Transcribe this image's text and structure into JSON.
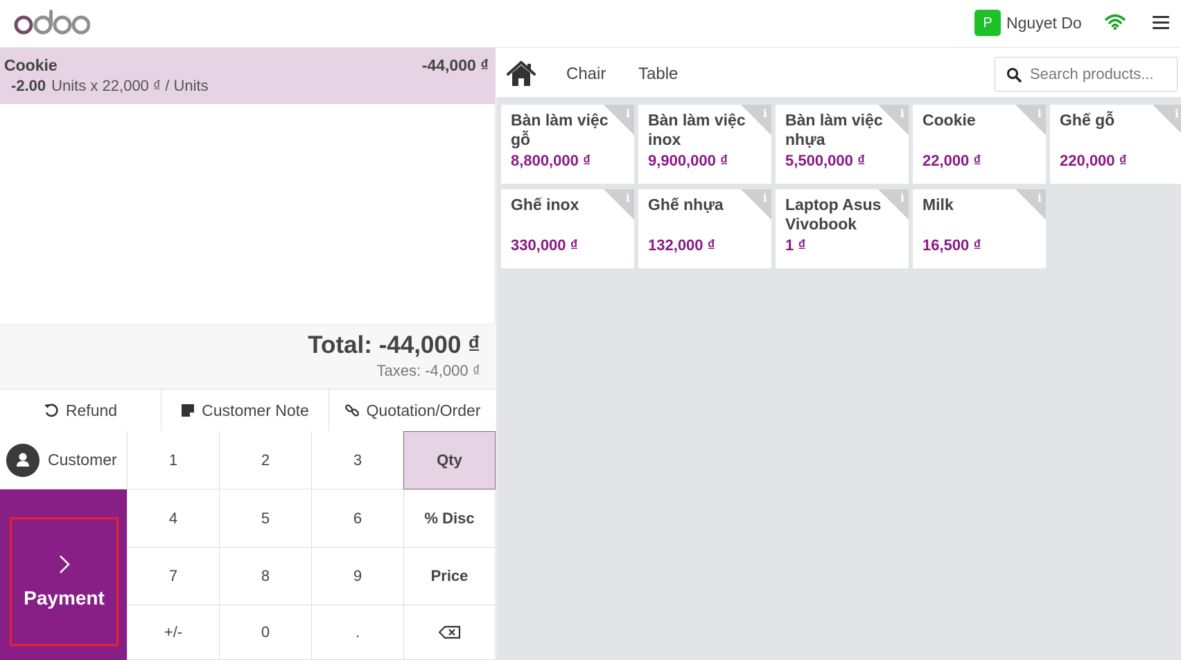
{
  "header": {
    "logo_text": "odoo",
    "user_initial": "P",
    "user_name": "Nguyet Do",
    "icons": [
      "wifi-icon",
      "hamburger-menu-icon"
    ]
  },
  "order": {
    "lines": [
      {
        "product": "Cookie",
        "line_total": "-44,000 ₫",
        "quantity": "-2.00",
        "detail": "Units x 22,000 ₫ / Units"
      }
    ],
    "total": "Total: -44,000 ₫",
    "taxes": "Taxes: -4,000 ₫"
  },
  "controls": {
    "refund": "Refund",
    "customer_note": "Customer Note",
    "quotation": "Quotation/Order",
    "customer": "Customer",
    "payment": "Payment"
  },
  "numpad": {
    "keys": [
      "1",
      "2",
      "3",
      "Qty",
      "4",
      "5",
      "6",
      "% Disc",
      "7",
      "8",
      "9",
      "Price",
      "+/-",
      "0",
      ".",
      "⌫"
    ],
    "active_mode": "Qty"
  },
  "categories": {
    "items": [
      "Chair",
      "Table"
    ],
    "search_placeholder": "Search products..."
  },
  "products": [
    {
      "name": "Bàn làm việc gỗ",
      "price": "8,800,000 ₫"
    },
    {
      "name": "Bàn làm việc inox",
      "price": "9,900,000 ₫"
    },
    {
      "name": "Bàn làm việc nhựa",
      "price": "5,500,000 ₫"
    },
    {
      "name": "Cookie",
      "price": "22,000 ₫"
    },
    {
      "name": "Ghế gỗ",
      "price": "220,000 ₫"
    },
    {
      "name": "Ghế inox",
      "price": "330,000 ₫"
    },
    {
      "name": "Ghế nhựa",
      "price": "132,000 ₫"
    },
    {
      "name": "Laptop Asus Vivobook",
      "price": "1 ₫"
    },
    {
      "name": "Milk",
      "price": "16,500 ₫"
    }
  ],
  "colors": {
    "brand_purple": "#871f87",
    "selected_line": "#e6d3e3",
    "price_purple": "#8a1a86",
    "highlight_red": "#e8222a"
  }
}
